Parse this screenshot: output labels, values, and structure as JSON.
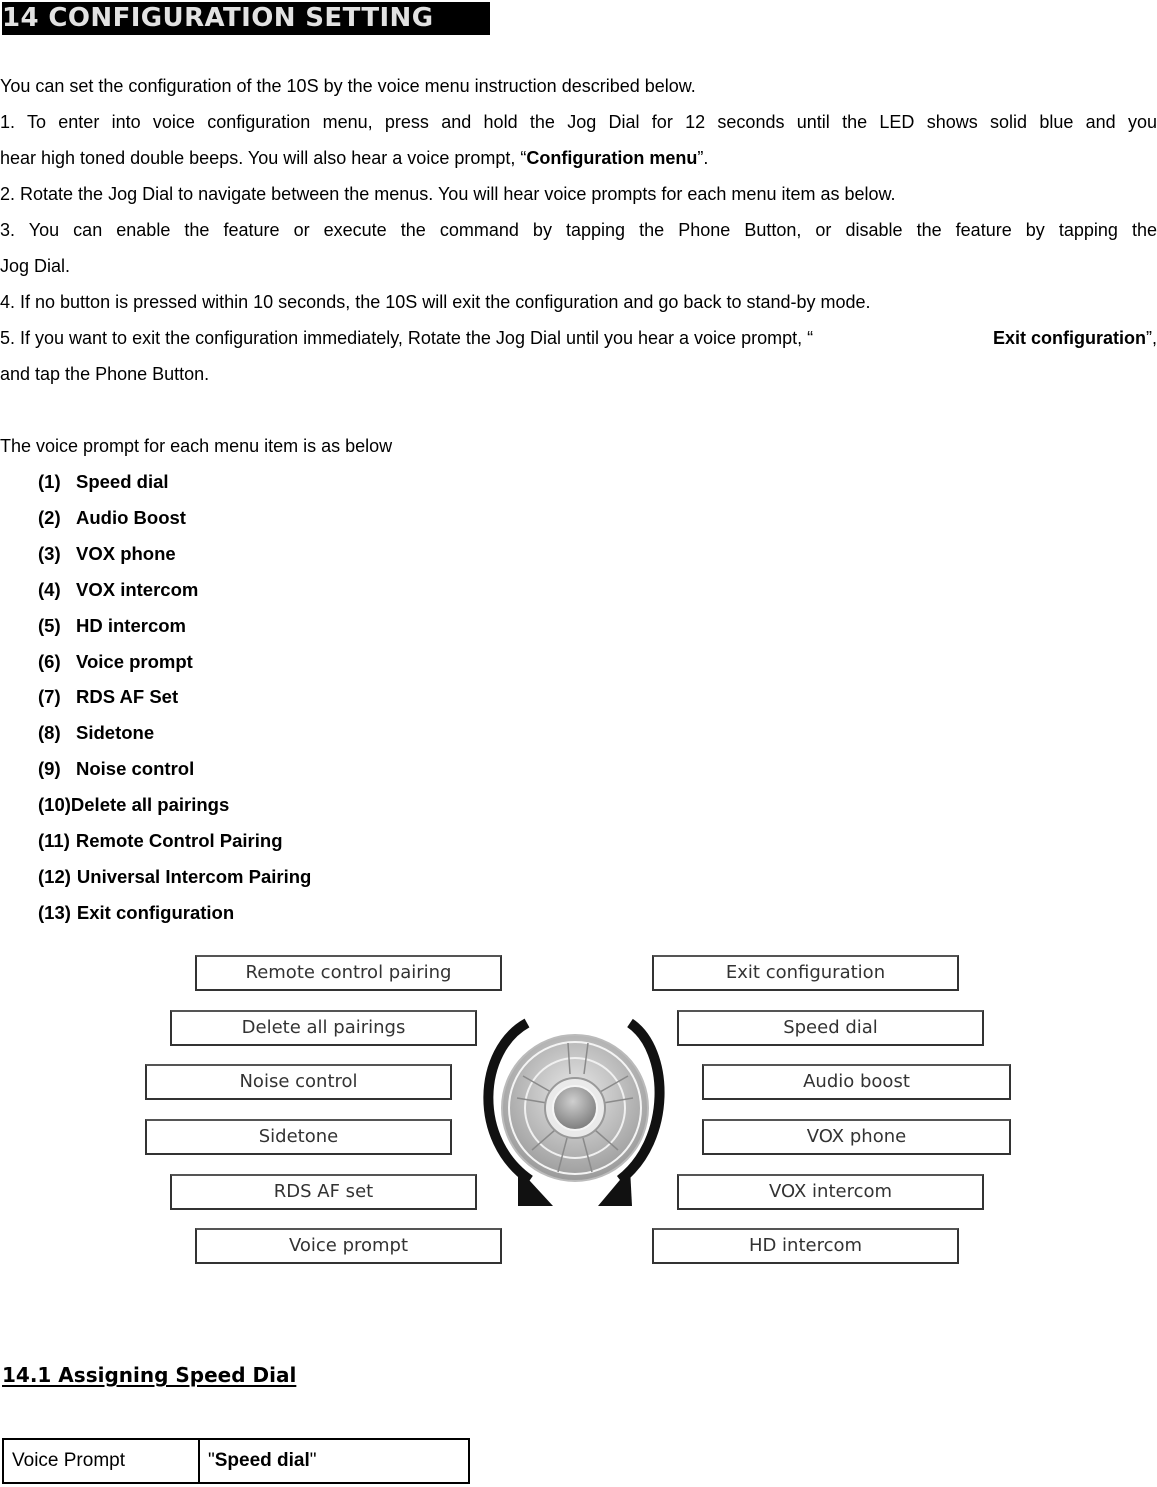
{
  "heading": "14 CONFIGURATION SETTING",
  "intro": "You can set the configuration of the 10S by the voice menu instruction described below.",
  "steps": [
    {
      "pre": "1. To enter into voice configuration menu, press and hold the Jog Dial for 12 seconds until the LED shows solid blue and you",
      "line2_pre": "hear high toned double beeps. You will also hear a voice prompt, “",
      "bold": "Configuration menu",
      "post": "”."
    },
    {
      "text": "2. Rotate the Jog Dial to navigate between the menus. You will hear voice prompts for each menu item as below."
    },
    {
      "line1": "3. You can enable the feature or execute the command by tapping the Phone Button, or disable the feature by tapping the",
      "line2": "Jog Dial."
    },
    {
      "text": "4. If no button is pressed within 10 seconds, the 10S will exit the configuration and go back to stand-by mode."
    },
    {
      "pre": "5. If you want to exit the configuration immediately, Rotate the Jog Dial until you hear a voice prompt, “",
      "bold": "Exit configuration",
      "post": "”,",
      "line2": "and tap the Phone Button."
    }
  ],
  "list_intro": "The voice prompt for each menu item is as below",
  "menu_items": [
    {
      "num": "(1)",
      "label": "Speed dial"
    },
    {
      "num": "(2)",
      "label": "Audio Boost"
    },
    {
      "num": "(3)",
      "label": "VOX phone"
    },
    {
      "num": "(4)",
      "label": "VOX intercom"
    },
    {
      "num": "(5)",
      "label": "HD intercom"
    },
    {
      "num": "(6)",
      "label": "Voice prompt"
    },
    {
      "num": "(7)",
      "label": "RDS AF Set"
    },
    {
      "num": "(8)",
      "label": "Sidetone"
    },
    {
      "num": "(9)",
      "label": "Noise control"
    },
    {
      "num": "(10)",
      "label": "Delete all pairings"
    },
    {
      "num": "(11)",
      "label": "Remote Control Pairing"
    },
    {
      "num": "(12)",
      "label": "Universal Intercom Pairing"
    },
    {
      "num": "(13)",
      "label": "Exit configuration"
    }
  ],
  "diagram": {
    "left_boxes": [
      "Remote control pairing",
      "Delete all pairings",
      "Noise control",
      "Sidetone",
      "RDS AF set",
      "Voice prompt"
    ],
    "right_boxes": [
      "Exit configuration",
      "Speed dial",
      "Audio boost",
      "VOX phone",
      "VOX intercom",
      "HD intercom"
    ]
  },
  "section": {
    "title": "14.1 Assigning Speed Dial",
    "table": {
      "label": "Voice Prompt",
      "value_quote_open": "\"",
      "value": "Speed dial",
      "value_quote_close": "\""
    }
  }
}
